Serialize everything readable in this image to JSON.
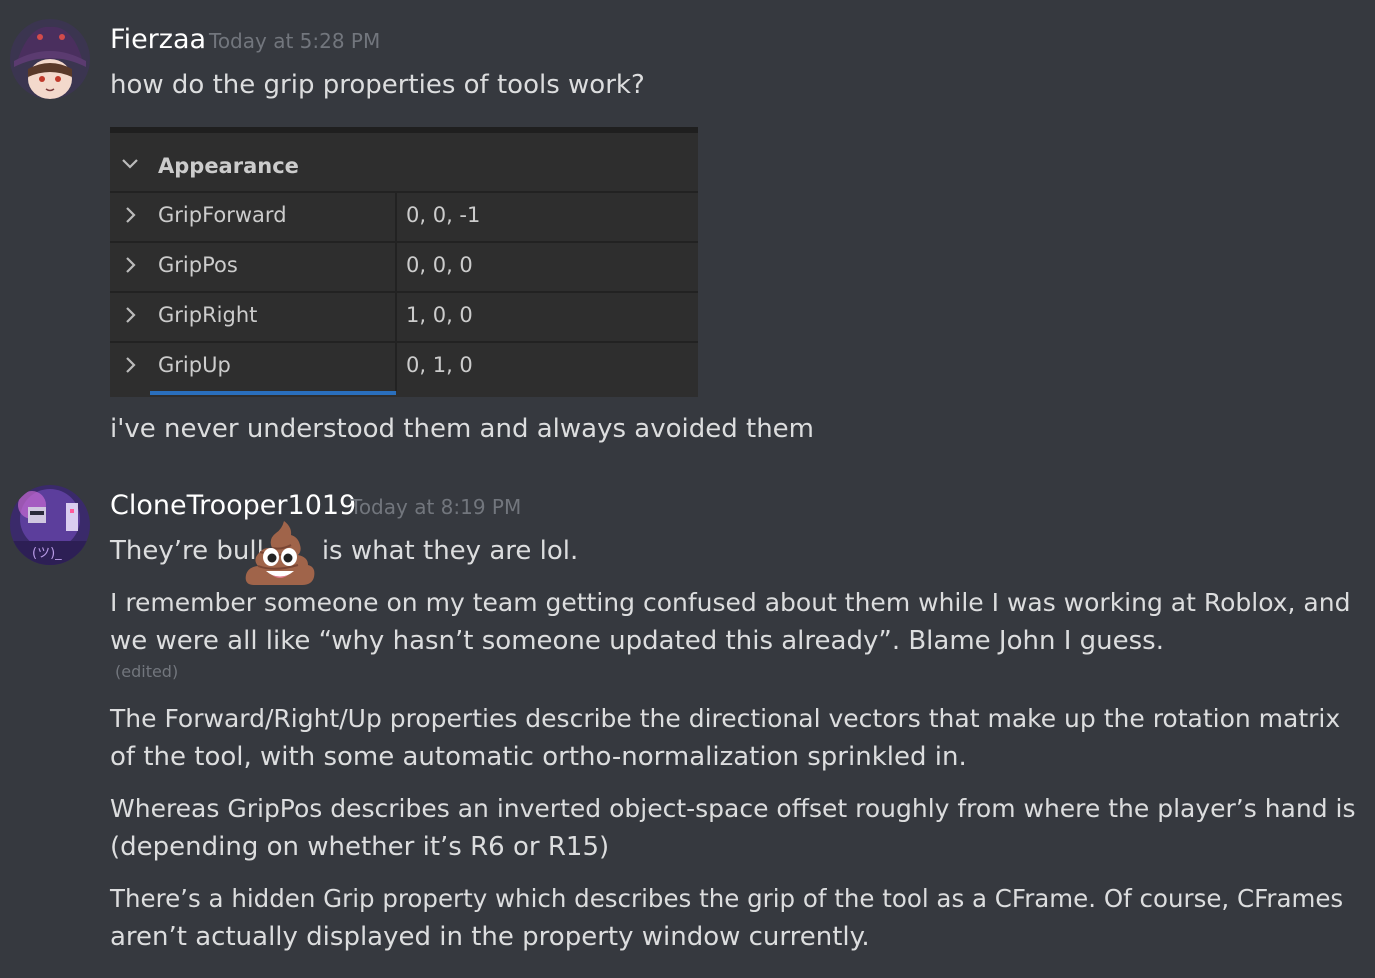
{
  "messages": [
    {
      "username": "Fierzaa",
      "timestamp": "Today at 5:28 PM",
      "lines": [
        "how do the grip properties of tools work?",
        "i've never understood them and always avoided them"
      ],
      "attachment": {
        "category": "Appearance",
        "properties": [
          {
            "name": "GripForward",
            "value": "0, 0, -1"
          },
          {
            "name": "GripPos",
            "value": "0, 0, 0"
          },
          {
            "name": "GripRight",
            "value": "1, 0, 0"
          },
          {
            "name": "GripUp",
            "value": "0, 1, 0"
          }
        ]
      }
    },
    {
      "username": "CloneTrooper1019",
      "timestamp": "Today at 8:19 PM",
      "avatar_text": "(ツ)_",
      "emoji_line": {
        "before": "They’re bull",
        "emoji": "poop-emoji",
        "after": "is what they are lol."
      },
      "paragraphs": [
        [
          "I remember someone on my team getting confused about them while I was working at Roblox, and",
          "we were all like “why hasn’t someone updated this already”. Blame John I guess."
        ],
        [
          "The Forward/Right/Up properties describe the directional vectors that make up the rotation matrix",
          "of the tool, with some automatic ortho-normalization sprinkled in."
        ],
        [
          "Whereas GripPos describes an inverted object-space offset roughly from where the player’s hand is",
          "(depending on whether it’s R6 or R15)"
        ],
        [
          "There’s a hidden Grip property which describes the grip of the tool as a CFrame. Of course, CFrames",
          "aren’t actually displayed in the property window currently."
        ]
      ],
      "edited_label": "(edited)"
    }
  ],
  "colors": {
    "background": "#36393f",
    "username": "#ffffff",
    "text": "#dcddde",
    "timestamp": "#72767d",
    "panel_bg": "#2e2e2e",
    "selection": "#2a6fbd"
  }
}
